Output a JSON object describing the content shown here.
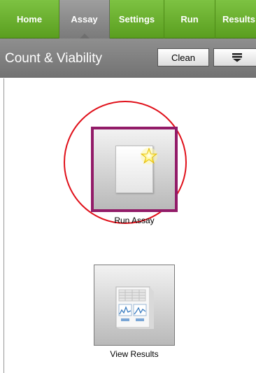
{
  "nav": {
    "tabs": [
      {
        "label": "Home",
        "active": false
      },
      {
        "label": "Assay",
        "active": true
      },
      {
        "label": "Settings",
        "active": false
      },
      {
        "label": "Run",
        "active": false
      },
      {
        "label": "Results",
        "active": false
      }
    ]
  },
  "titlebar": {
    "title": "Count & Viability",
    "clean_label": "Clean",
    "menu_icon": "menu-down-icon"
  },
  "main": {
    "run_assay": {
      "label": "Run Assay",
      "icon": "document-star-icon"
    },
    "view_results": {
      "label": "View Results",
      "icon": "report-chart-icon"
    }
  },
  "colors": {
    "nav_green": "#6cb232",
    "active_tab_grey": "#8a8a8a",
    "title_bar_grey": "#808080",
    "selection_purple": "#921b68",
    "highlight_red": "#e0101a"
  }
}
